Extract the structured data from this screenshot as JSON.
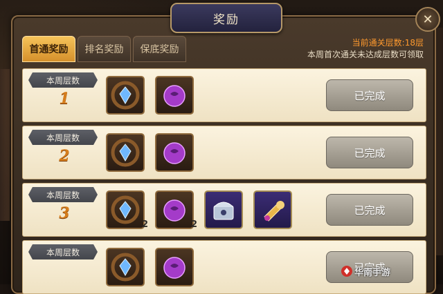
{
  "window": {
    "title": "奖励",
    "close_glyph": "✕"
  },
  "tabs": [
    {
      "label": "首通奖励",
      "active": true
    },
    {
      "label": "排名奖励",
      "active": false
    },
    {
      "label": "保底奖励",
      "active": false
    }
  ],
  "info": {
    "current_floor": "当前通关层数:18层",
    "notice": "本周首次通关未达成层数可领取"
  },
  "rows": [
    {
      "label": "本周层数",
      "floor": "1",
      "items": [
        {
          "icon": "blue-crystal-icon",
          "qty": ""
        },
        {
          "icon": "purple-orb-icon",
          "qty": ""
        }
      ],
      "status": "已完成"
    },
    {
      "label": "本周层数",
      "floor": "2",
      "items": [
        {
          "icon": "blue-crystal-icon",
          "qty": ""
        },
        {
          "icon": "purple-orb-icon",
          "qty": ""
        }
      ],
      "status": "已完成"
    },
    {
      "label": "本周层数",
      "floor": "3",
      "items": [
        {
          "icon": "blue-crystal-icon",
          "qty": "2"
        },
        {
          "icon": "purple-orb-icon",
          "qty": "2"
        },
        {
          "icon": "treasure-chest-icon",
          "qty": ""
        },
        {
          "icon": "golden-horn-icon",
          "qty": ""
        }
      ],
      "status": "已完成"
    },
    {
      "label": "本周层数",
      "floor": "",
      "items": [
        {
          "icon": "blue-crystal-icon",
          "qty": ""
        },
        {
          "icon": "purple-orb-icon",
          "qty": ""
        }
      ],
      "status": "已完成"
    }
  ],
  "watermark": "华南手游",
  "colors": {
    "accent": "#f0b24a",
    "warning": "#ff9a2e",
    "floor": "#d67d1c"
  }
}
